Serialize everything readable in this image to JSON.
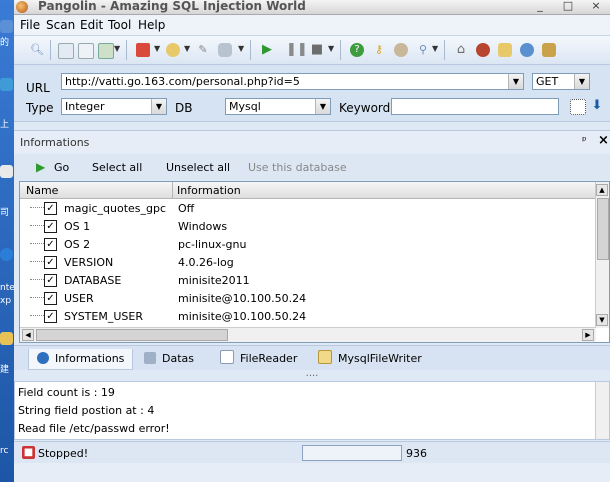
{
  "desktop": {
    "icon_labels": [
      "的",
      "上",
      "司",
      "nte",
      "xp",
      "建",
      "rc"
    ]
  },
  "window": {
    "title": "Pangolin - Amazing SQL Injection World",
    "controls": [
      "_",
      "□",
      "×"
    ]
  },
  "menu": [
    "File",
    "Scan",
    "Edit",
    "Tool",
    "Help"
  ],
  "toolbar_icons": [
    "search-icon",
    "page-icon",
    "document-icon",
    "export-icon",
    "stack-icon",
    "puzzle-icon",
    "wrench-icon",
    "database-icon",
    "play-icon",
    "pause-icon",
    "stop-icon",
    "help-icon",
    "key-icon",
    "user-search-icon",
    "magnifier-icon",
    "home-icon",
    "bug-icon",
    "gear-icon",
    "world-icon"
  ],
  "url_form": {
    "url_label": "URL",
    "url_value": "http://vatti.go.163.com/personal.php?id=5",
    "method_value": "GET",
    "type_label": "Type",
    "type_value": "Integer",
    "db_label": "DB",
    "db_value": "Mysql",
    "keyword_label": "Keyword",
    "keyword_value": ""
  },
  "info_panel": {
    "title": "Informations",
    "pin": "ᵖ",
    "close": "×",
    "actions": {
      "go": "Go",
      "select_all": "Select all",
      "unselect_all": "Unselect all",
      "use_db": "Use this database"
    },
    "columns": [
      "Name",
      "Information"
    ],
    "rows": [
      {
        "name": "magic_quotes_gpc",
        "info": "Off",
        "checked": true
      },
      {
        "name": "OS 1",
        "info": "Windows",
        "checked": true
      },
      {
        "name": "OS 2",
        "info": "pc-linux-gnu",
        "checked": true
      },
      {
        "name": "VERSION",
        "info": "4.0.26-log",
        "checked": true
      },
      {
        "name": "DATABASE",
        "info": "minisite2011",
        "checked": true
      },
      {
        "name": "USER",
        "info": "minisite@10.100.50.24",
        "checked": true
      },
      {
        "name": "SYSTEM_USER",
        "info": "minisite@10.100.50.24",
        "checked": true
      }
    ]
  },
  "tabs": [
    "Informations",
    "Datas",
    "FileReader",
    "MysqlFileWriter"
  ],
  "splitter_grip": "....",
  "log_lines": [
    "Field count is : 19",
    "String field postion at : 4",
    "Read file /etc/passwd error!"
  ],
  "status": {
    "text": "Stopped!",
    "count": "936"
  },
  "colors": {
    "accent_blue": "#1c5aa8",
    "go_green": "#2e9a2e"
  }
}
